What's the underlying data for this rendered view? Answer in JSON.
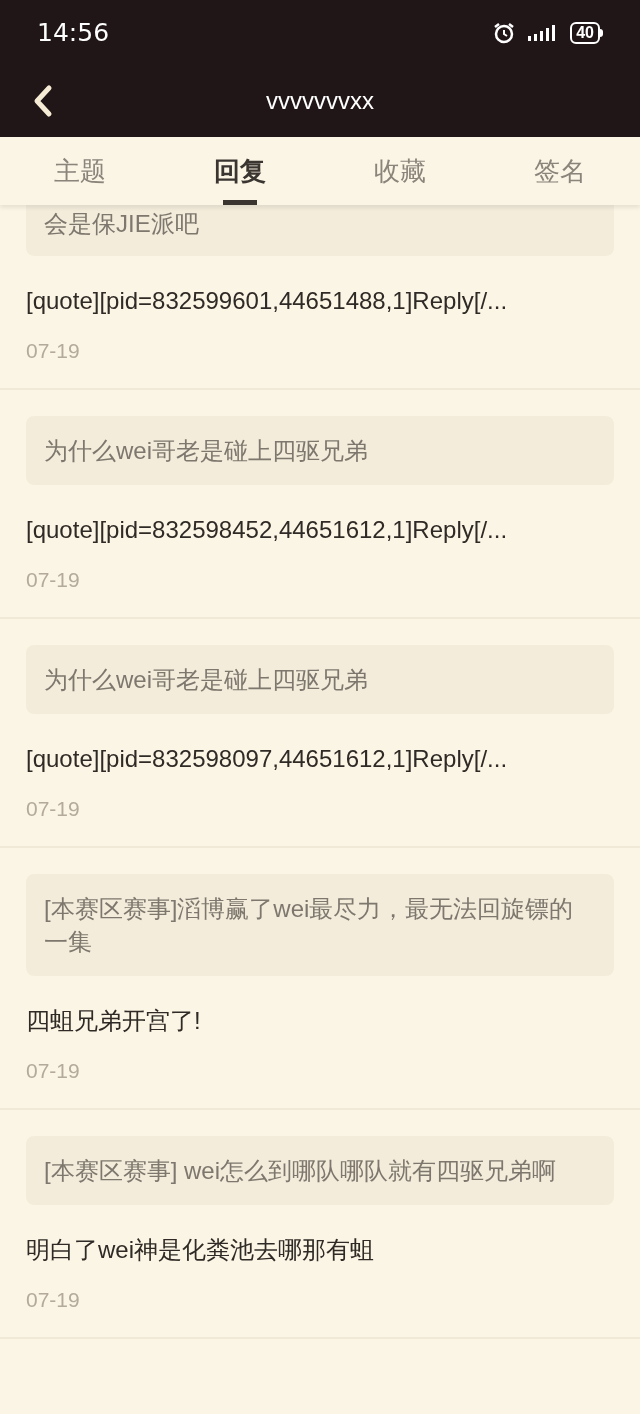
{
  "status_bar": {
    "time": "14:56",
    "battery": "40"
  },
  "header": {
    "title": "vvvvvvvxx"
  },
  "tabs": [
    {
      "label": "主题",
      "selected": false
    },
    {
      "label": "回复",
      "selected": true
    },
    {
      "label": "收藏",
      "selected": false
    },
    {
      "label": "签名",
      "selected": false
    }
  ],
  "posts": [
    {
      "quote": "会是保JIE派吧",
      "reply": "[quote][pid=832599601,44651488,1]Reply[/...",
      "date": "07-19"
    },
    {
      "quote": "为什么wei哥老是碰上四驱兄弟",
      "reply": "[quote][pid=832598452,44651612,1]Reply[/...",
      "date": "07-19"
    },
    {
      "quote": "为什么wei哥老是碰上四驱兄弟",
      "reply": "[quote][pid=832598097,44651612,1]Reply[/...",
      "date": "07-19"
    },
    {
      "quote": "[本赛区赛事]滔博赢了wei最尽力，最无法回旋镖的一集",
      "reply": "四蛆兄弟开宫了!",
      "date": "07-19"
    },
    {
      "quote": "[本赛区赛事] wei怎么到哪队哪队就有四驱兄弟啊",
      "reply": "明白了wei神是化粪池去哪那有蛆",
      "date": "07-19"
    }
  ]
}
